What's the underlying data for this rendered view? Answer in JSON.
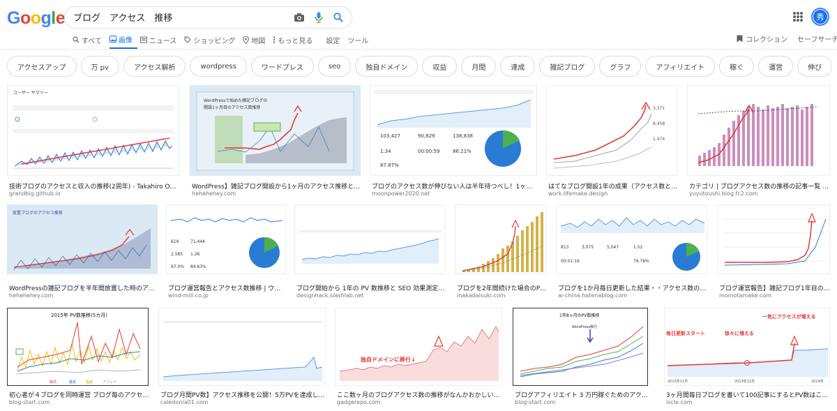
{
  "search": {
    "query": "ブログ　アクセス　推移"
  },
  "logo": [
    "G",
    "o",
    "o",
    "g",
    "l",
    "e"
  ],
  "nav": {
    "items": [
      {
        "label": "すべて",
        "icon": "search-icon"
      },
      {
        "label": "画像",
        "icon": "image-icon",
        "active": true
      },
      {
        "label": "ニュース",
        "icon": "news-icon"
      },
      {
        "label": "ショッピング",
        "icon": "tag-icon"
      },
      {
        "label": "地図",
        "icon": "map-pin-icon"
      },
      {
        "label": "もっと見る",
        "icon": "more-vert-icon"
      },
      {
        "label": "設定",
        "icon": ""
      },
      {
        "label": "ツール",
        "icon": ""
      }
    ],
    "collection": "コレクション",
    "safesearch": "セーフサーチ・"
  },
  "avatar": "秀",
  "chips": [
    "アクセスアップ",
    "万 pv",
    "アクセス解析",
    "wordpress",
    "ワードプレス",
    "seo",
    "独自ドメイン",
    "収益",
    "月間",
    "達成",
    "雑記ブログ",
    "グラフ",
    "アフィリエイト",
    "稼ぐ",
    "運営",
    "伸び"
  ],
  "results": [
    {
      "title": "技術ブログのアクセスと収入の推移(2周年) - Takahiro Octopress Bl...",
      "source": "grandbig.github.io"
    },
    {
      "title": "WordPress】雑記ブログ開設から1ヶ月のアクセス推移と運営報告 ...",
      "source": "hehehehey.com"
    },
    {
      "title": "ブログのアクセス数が伸びない人は半年待つべし！1ヶ月目のア...",
      "source": "moonpower2020.net"
    },
    {
      "title": "はてなブログ開設1年の成果（アクセス数とか広告...",
      "source": "work.lifemake.design"
    },
    {
      "title": "カテゴリ | ブログアクセス数の推移の記事一覧 | ゆうゆ...",
      "source": "yuyutoushi.blog.fc2.com"
    },
    {
      "title": "WordPressの雑記ブログを半年間放置した時のアクセス数...",
      "source": "hehehehey.com"
    },
    {
      "title": "ブログ運営報告とアクセス数推移 | ウインド...",
      "source": "wind-mill.co.jp"
    },
    {
      "title": "ブログ開始から 1年の PV 数推移と SEO 効果測定 | Design...",
      "source": "designhack.slashlab.net"
    },
    {
      "title": "ブログを2年間続けた場合のPV数...",
      "source": "inakadaisuki.com"
    },
    {
      "title": "ブログを1か月毎日更新した結果・・アクセス数の推移や...",
      "source": "ai-china.hatenablog.com"
    },
    {
      "title": "ブログ運営報告】雑記ブログ1年目のリアル...",
      "source": "momotamake.com"
    },
    {
      "title": "初心者が４ブログを同時運営 ブログ毎のアクセス数推...",
      "source": "blog-start.com"
    },
    {
      "title": "ブログ月間PV数】アクセス推移を公開！5万PVを達成して...10万...",
      "source": "caledonia01.com"
    },
    {
      "title": "ここ数ヶ月のブログアクセス数の推移がなんかおかしい件。 - ガ...",
      "source": "gadgerepo.com"
    },
    {
      "title": "ブログアフィリエイト 3 万円稼ぐためのアクセス数は？",
      "source": "blog-start.com"
    },
    {
      "title": "3ヶ月間毎日ブログを書いて100記事にするとPV数はこうなるん...",
      "source": "iscle.com"
    }
  ],
  "thumb_text": {
    "t1_header": "ユーザー サマリー",
    "t2_title1": "WordPressで始めた雑記ブログの",
    "t2_title2": "開設1ヶ月目のアクセス数推移",
    "t3_n1": "103,427",
    "t3_n2": "90,829",
    "t3_n3": "138,838",
    "t3_n4": "1.34",
    "t3_n5": "00:00:59",
    "t3_n6": "86.21%",
    "t3_n7": "87.87%",
    "t4_v1": "3,371",
    "t4_v2": "8,458",
    "t4_v3": "1,474",
    "t6_title": "放置ブログのアクセス推移",
    "t7_n1": "619",
    "t7_n2": "71,444",
    "t7_n3": "2,585",
    "t7_n4": "1.26",
    "t7_n5": "97.0%",
    "t7_n6": "84.63%",
    "t10_n1": "813",
    "t10_n2": "3,075",
    "t10_n3": "5,047",
    "t10_n4": "1.52",
    "t10_n5": "00:01:16",
    "t10_n6": "76.76%",
    "t12_title": "2015年 PV数推移(5カ月)",
    "t12_leg": [
      "株式",
      "雑系",
      "投資",
      "アフィリ"
    ],
    "t14_label": "独自ドメインに移行↓",
    "t15_title": "1年8ヵ月のPV数推移",
    "t15_note": "WordPress移行",
    "t16_a": "毎日更新スタート",
    "t16_b": "徐々に増える",
    "t16_c": "一気にアクセスが増える",
    "t16_x1": "2013年11月",
    "t16_x2": "2013年12月",
    "t16_x3": "2014年"
  }
}
